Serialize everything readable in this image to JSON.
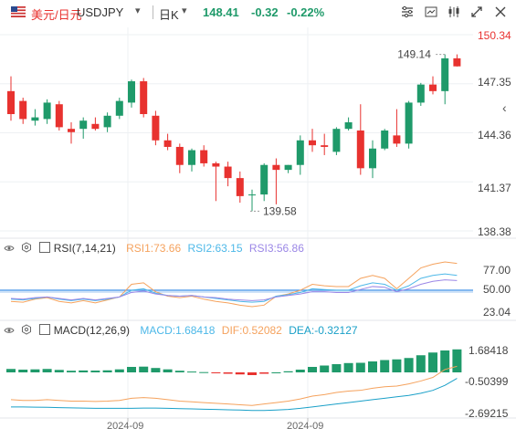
{
  "header": {
    "pair_cn": "美元/日元",
    "symbol": "USDJPY",
    "period": "日K",
    "price": "148.41",
    "change": "-0.32",
    "change_pct": "-0.22%",
    "toolbar_icons": [
      "chart-settings-icon",
      "layout-icon",
      "indicator-icon",
      "expand-icon",
      "close-icon"
    ]
  },
  "price_axis": {
    "labels": [
      "150.34",
      "147.35",
      "144.36",
      "141.37",
      "138.38"
    ],
    "high_label": "149.14",
    "low_label": "139.58"
  },
  "rsi": {
    "title": "RSI(7,14,21)",
    "rsi1": "RSI1:73.66",
    "rsi2": "RSI2:63.15",
    "rsi3": "RSI3:56.86",
    "axis": [
      "77.00",
      "50.00",
      "23.04"
    ],
    "colors": {
      "rsi1": "#f5a25d",
      "rsi2": "#4db8e8",
      "rsi3": "#9b87e6"
    }
  },
  "macd": {
    "title": "MACD(12,26,9)",
    "macd": "MACD:1.68418",
    "dif": "DIF:0.52082",
    "dea": "DEA:-0.32127",
    "axis": [
      "1.68418",
      "-0.50399",
      "-2.69215"
    ],
    "colors": {
      "macd": "#4db8e8",
      "dif": "#f5a25d",
      "dea": "#1aa0c8"
    }
  },
  "x_axis": [
    "2024-09",
    "2024-09"
  ],
  "colors": {
    "up": "#1f9a6a",
    "down": "#e8322f"
  },
  "candles": [
    [
      146.9,
      147.8,
      145.1,
      145.5
    ],
    [
      146.3,
      146.5,
      144.9,
      145.2
    ],
    [
      145.1,
      145.8,
      144.8,
      145.3
    ],
    [
      145.2,
      146.4,
      144.9,
      146.2
    ],
    [
      146.1,
      146.3,
      144.5,
      144.7
    ],
    [
      144.6,
      145.0,
      143.7,
      144.4
    ],
    [
      144.6,
      145.3,
      144.0,
      145.1
    ],
    [
      144.9,
      145.3,
      144.5,
      144.6
    ],
    [
      144.7,
      145.6,
      144.4,
      145.4
    ],
    [
      145.4,
      146.5,
      145.2,
      146.3
    ],
    [
      146.2,
      147.6,
      145.9,
      147.5
    ],
    [
      147.5,
      147.7,
      145.3,
      145.5
    ],
    [
      145.4,
      145.7,
      143.6,
      143.9
    ],
    [
      143.9,
      144.3,
      143.3,
      143.5
    ],
    [
      143.5,
      143.7,
      141.9,
      142.4
    ],
    [
      142.4,
      143.4,
      142.0,
      143.3
    ],
    [
      143.3,
      143.6,
      142.3,
      142.5
    ],
    [
      142.5,
      142.6,
      140.2,
      142.3
    ],
    [
      142.3,
      142.6,
      141.1,
      141.6
    ],
    [
      141.6,
      142.0,
      140.1,
      140.5
    ],
    [
      140.6,
      140.9,
      139.58,
      140.6
    ],
    [
      140.6,
      142.5,
      140.2,
      142.4
    ],
    [
      142.4,
      142.8,
      140.0,
      142.1
    ],
    [
      142.1,
      142.4,
      141.9,
      142.4
    ],
    [
      142.4,
      144.2,
      141.8,
      143.9
    ],
    [
      143.9,
      144.6,
      143.2,
      143.6
    ],
    [
      143.6,
      144.3,
      143.0,
      143.5
    ],
    [
      143.2,
      144.7,
      143.0,
      144.6
    ],
    [
      144.6,
      145.3,
      144.5,
      145.0
    ],
    [
      144.5,
      146.1,
      141.8,
      142.2
    ],
    [
      142.2,
      143.9,
      141.6,
      143.4
    ],
    [
      143.4,
      144.6,
      143.3,
      144.5
    ],
    [
      144.2,
      145.8,
      143.5,
      143.7
    ],
    [
      143.7,
      146.3,
      143.4,
      146.2
    ],
    [
      146.2,
      147.4,
      146.0,
      147.3
    ],
    [
      147.3,
      147.8,
      146.7,
      146.9
    ],
    [
      146.9,
      149.14,
      146.1,
      148.9
    ],
    [
      148.9,
      149.14,
      148.4,
      148.41
    ]
  ],
  "rsi_values": {
    "rsi1": [
      35,
      34,
      38,
      40,
      35,
      33,
      36,
      33,
      37,
      41,
      58,
      60,
      48,
      42,
      40,
      42,
      38,
      35,
      33,
      30,
      28,
      30,
      42,
      45,
      50,
      58,
      56,
      55,
      55,
      66,
      70,
      66,
      52,
      66,
      80,
      85,
      88,
      86
    ],
    "rsi2": [
      38,
      37,
      39,
      41,
      38,
      36,
      38,
      36,
      38,
      41,
      50,
      52,
      46,
      43,
      42,
      43,
      41,
      39,
      37,
      35,
      34,
      35,
      42,
      44,
      47,
      52,
      51,
      50,
      50,
      56,
      60,
      58,
      50,
      56,
      66,
      70,
      72,
      70
    ],
    "rsi3": [
      39,
      38,
      40,
      41,
      39,
      37,
      39,
      37,
      39,
      41,
      47,
      49,
      45,
      43,
      42,
      43,
      41,
      40,
      38,
      37,
      36,
      37,
      41,
      43,
      45,
      48,
      48,
      47,
      47,
      51,
      55,
      54,
      48,
      52,
      58,
      62,
      64,
      63
    ]
  },
  "macd_values": {
    "hist": [
      0.25,
      0.2,
      0.22,
      0.25,
      0.18,
      0.12,
      0.14,
      0.13,
      0.15,
      0.22,
      0.4,
      0.42,
      0.32,
      0.22,
      0.12,
      0.06,
      0.02,
      -0.05,
      -0.1,
      -0.15,
      -0.2,
      -0.1,
      0.0,
      0.08,
      0.2,
      0.4,
      0.5,
      0.6,
      0.68,
      0.7,
      0.8,
      0.9,
      0.95,
      1.05,
      1.25,
      1.45,
      1.6,
      1.68
    ],
    "dif": [
      -1.8,
      -1.85,
      -1.85,
      -1.8,
      -1.85,
      -1.9,
      -1.9,
      -1.92,
      -1.9,
      -1.85,
      -1.7,
      -1.65,
      -1.7,
      -1.8,
      -1.9,
      -1.95,
      -2.0,
      -2.05,
      -2.1,
      -2.15,
      -2.2,
      -2.1,
      -2.0,
      -1.9,
      -1.75,
      -1.55,
      -1.45,
      -1.3,
      -1.2,
      -1.15,
      -1.0,
      -0.9,
      -0.85,
      -0.7,
      -0.5,
      -0.25,
      0.3,
      0.52
    ],
    "dea": [
      -2.3,
      -2.3,
      -2.32,
      -2.33,
      -2.35,
      -2.37,
      -2.38,
      -2.4,
      -2.4,
      -2.4,
      -2.4,
      -2.38,
      -2.38,
      -2.4,
      -2.42,
      -2.44,
      -2.46,
      -2.48,
      -2.5,
      -2.52,
      -2.55,
      -2.55,
      -2.52,
      -2.48,
      -2.4,
      -2.3,
      -2.2,
      -2.1,
      -2.0,
      -1.9,
      -1.8,
      -1.7,
      -1.6,
      -1.5,
      -1.35,
      -1.15,
      -0.8,
      -0.32
    ]
  }
}
